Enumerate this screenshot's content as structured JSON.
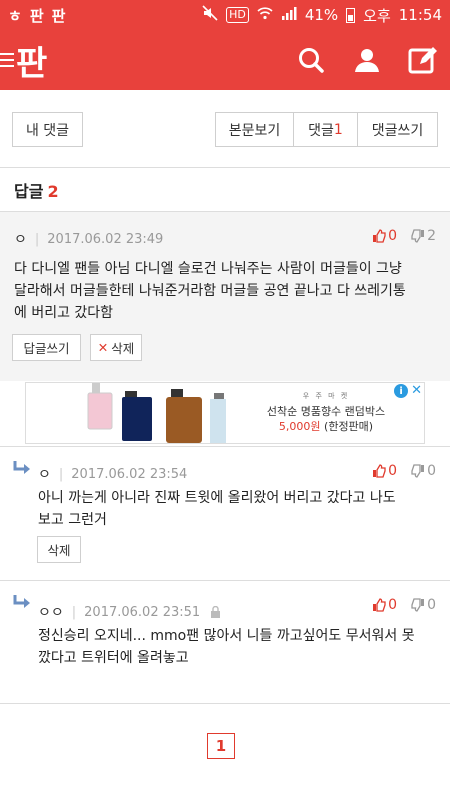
{
  "status_bar": {
    "app_icons": [
      "ㅎ",
      "판",
      "판"
    ],
    "hd": "HD",
    "battery": "41%",
    "ampm": "오후",
    "time": "11:54"
  },
  "header": {
    "logo": "판",
    "icons": [
      "menu-icon",
      "search-icon",
      "user-icon",
      "edit-icon"
    ]
  },
  "toolbar": {
    "my_comments": "내 댓글",
    "view_post": "본문보기",
    "comments_label": "댓글",
    "comments_count": "1",
    "write_comment": "댓글쓰기"
  },
  "replies": {
    "title": "답글",
    "count": "2"
  },
  "comments": [
    {
      "name": "ㅇ",
      "date": "2017.06.02 23:49",
      "up": "0",
      "down": "2",
      "text_lines": [
        "다 다니엘 팬들 아님 다니엘 슬로건 나눠주는 사람이 머글들이 그냥",
        "달라해서 머글들한테 나눠준거라함 머글들 공연 끝나고 다 쓰레기통",
        "에 버리고 갔다함"
      ],
      "reply_btn": "답글쓰기",
      "delete_btn": "삭제"
    },
    {
      "name": "ㅇ",
      "date": "2017.06.02 23:54",
      "up": "0",
      "down": "0",
      "text_lines": [
        "아니 까는게 아니라 진짜 트윗에 올리왔어 버리고 갔다고 나도",
        "보고 그런거"
      ],
      "delete_btn": "삭제"
    },
    {
      "name": "ㅇㅇ",
      "date": "2017.06.02 23:51",
      "up": "0",
      "down": "0",
      "text_lines": [
        "정신승리 오지네... mmo팬 많아서 니들 까고싶어도 무서워서 못",
        "깠다고 트위터에 올려놓고"
      ]
    }
  ],
  "ad": {
    "brand": "우 주 마 켓",
    "line1": "선착순 명품향수 랜덤박스",
    "price": "5,000원",
    "suffix": " (한정판매)",
    "info_label": "i",
    "close_label": "✕"
  },
  "pagination": {
    "current": "1"
  },
  "colors": {
    "brand_red": "#e8413c",
    "accent_red": "#e03a2d"
  }
}
